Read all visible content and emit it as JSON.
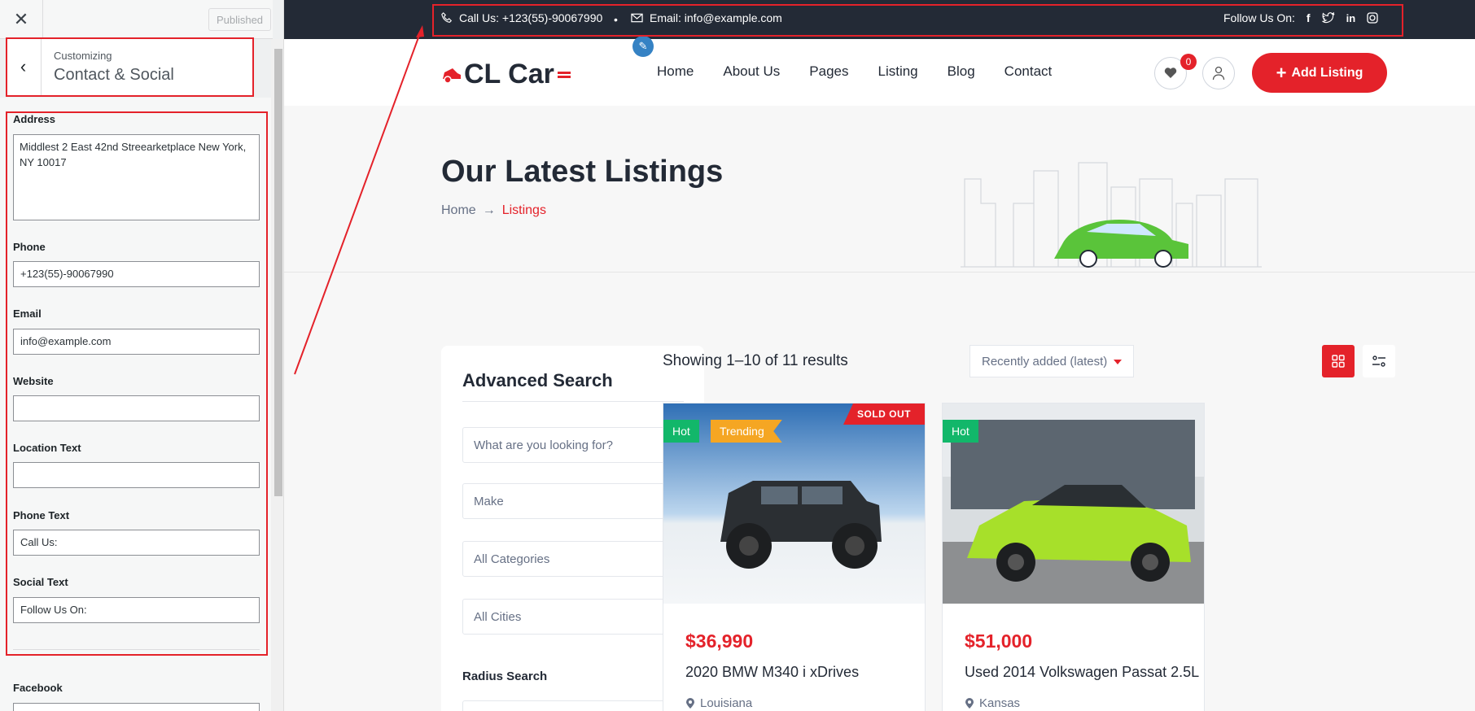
{
  "customizer": {
    "close_icon": "close-icon",
    "published_label": "Published",
    "section_sub": "Customizing",
    "section_title": "Contact & Social",
    "fields": {
      "address": {
        "label": "Address",
        "value": "Middlest 2 East 42nd Streearketplace New York, NY 10017"
      },
      "phone": {
        "label": "Phone",
        "value": "+123(55)-90067990"
      },
      "email": {
        "label": "Email",
        "value": "info@example.com"
      },
      "website": {
        "label": "Website",
        "value": ""
      },
      "location_text": {
        "label": "Location Text",
        "value": ""
      },
      "phone_text": {
        "label": "Phone Text",
        "value": "Call Us:"
      },
      "social_text": {
        "label": "Social Text",
        "value": "Follow Us On:"
      },
      "facebook": {
        "label": "Facebook",
        "value": ""
      }
    }
  },
  "topbar": {
    "call": "Call Us: +123(55)-90067990",
    "email": "Email: info@example.com",
    "follow": "Follow Us On:",
    "social_icons": [
      "facebook-icon",
      "twitter-icon",
      "linkedin-icon",
      "instagram-icon"
    ]
  },
  "header": {
    "logo": "CL Car",
    "nav": [
      "Home",
      "About Us",
      "Pages",
      "Listing",
      "Blog",
      "Contact"
    ],
    "wishlist_count": "0",
    "add_listing": "Add Listing"
  },
  "hero": {
    "title": "Our Latest Listings",
    "crumb_home": "Home",
    "crumb_current": "Listings"
  },
  "search": {
    "title": "Advanced Search",
    "keyword_placeholder": "What are you looking for?",
    "make": "Make",
    "categories": "All Categories",
    "cities": "All Cities",
    "radius": "Radius Search"
  },
  "listing": {
    "results": "Showing 1–10 of 11 results",
    "sort": "Recently added (latest)",
    "cards": [
      {
        "price": "$36,990",
        "title": "2020 BMW M340 i xDrives",
        "location": "Louisiana",
        "tags": [
          "Hot",
          "Trending"
        ],
        "status": "SOLD OUT"
      },
      {
        "price": "$51,000",
        "title": "Used 2014 Volkswagen Passat 2.5L",
        "location": "Kansas",
        "tags": [
          "Hot"
        ]
      }
    ]
  },
  "colors": {
    "accent": "#e4222a",
    "dark": "#232a36",
    "hot": "#12b76a",
    "trending": "#f5a623"
  }
}
